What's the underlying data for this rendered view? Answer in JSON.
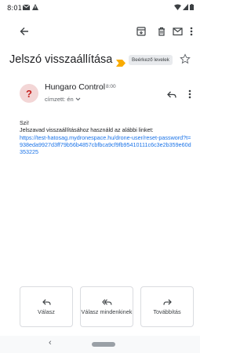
{
  "status": {
    "time": "8:01"
  },
  "subject": "Jelszó visszaállítása",
  "label": "Beérkező levelek",
  "sender": {
    "name": "Hungaro Control",
    "time": "8:00",
    "recipient": "címzett: én"
  },
  "body": {
    "greeting": "Szi!",
    "line1": "Jelszavad visszaállításához használd az alábbi linket:",
    "link": "https://test-hatosag.mydronespace.hu/drone-user/reset-password?t=938eda9927d3ff79b56b4857cbfbca9cf9fb95410111c6c3e2b359e60d353225"
  },
  "actions": {
    "reply": "Válasz",
    "reply_all": "Válasz mindenkinek",
    "forward": "Továbbítás"
  },
  "colors": {
    "accent": "#1a73e8",
    "important": "#f9ab00",
    "avatar_bg": "#f3d6d6",
    "avatar_fg": "#c5221f"
  }
}
